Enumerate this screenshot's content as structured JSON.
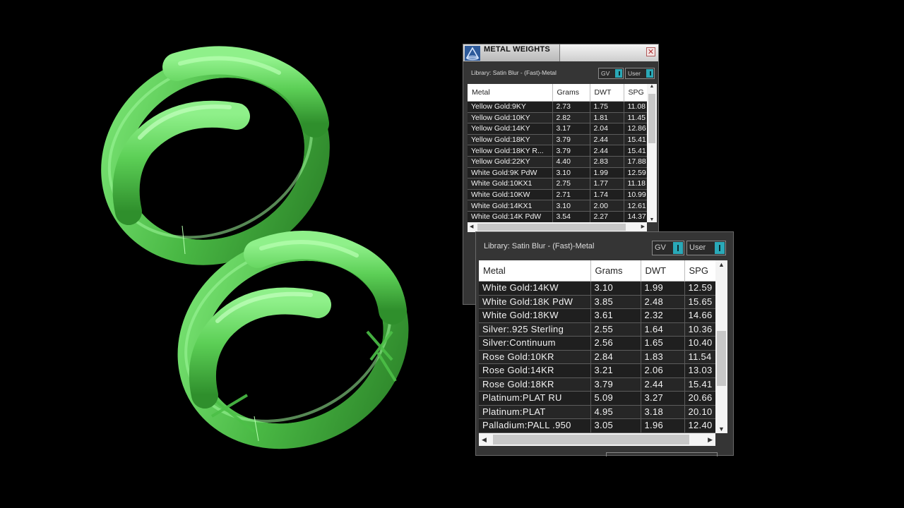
{
  "window1": {
    "title": "METAL WEIGHTS",
    "close_glyph": "✕",
    "library_label": "Library: Satin Blur - (Fast)-Metal",
    "toggle_gv": "GV",
    "toggle_user": "User",
    "columns": [
      "Metal",
      "Grams",
      "DWT",
      "SPG"
    ],
    "rows": [
      [
        "Yellow Gold:9KY",
        "2.73",
        "1.75",
        "11.08"
      ],
      [
        "Yellow Gold:10KY",
        "2.82",
        "1.81",
        "11.45"
      ],
      [
        "Yellow Gold:14KY",
        "3.17",
        "2.04",
        "12.86"
      ],
      [
        "Yellow Gold:18KY",
        "3.79",
        "2.44",
        "15.41"
      ],
      [
        "Yellow Gold:18KY R...",
        "3.79",
        "2.44",
        "15.41"
      ],
      [
        "Yellow Gold:22KY",
        "4.40",
        "2.83",
        "17.88"
      ],
      [
        "White Gold:9K PdW",
        "3.10",
        "1.99",
        "12.59"
      ],
      [
        "White Gold:10KX1",
        "2.75",
        "1.77",
        "11.18"
      ],
      [
        "White Gold:10KW",
        "2.71",
        "1.74",
        "10.99"
      ],
      [
        "White Gold:14KX1",
        "3.10",
        "2.00",
        "12.61"
      ],
      [
        "White Gold:14K PdW",
        "3.54",
        "2.27",
        "14.37"
      ]
    ],
    "scroll_up": "▲",
    "scroll_down": "▼",
    "scroll_left": "◀",
    "scroll_right": "▶"
  },
  "window2": {
    "library_label": "Library: Satin Blur - (Fast)-Metal",
    "toggle_gv": "GV",
    "toggle_user": "User",
    "columns": [
      "Metal",
      "Grams",
      "DWT",
      "SPG"
    ],
    "rows": [
      [
        "White Gold:14KW",
        "3.10",
        "1.99",
        "12.59"
      ],
      [
        "White Gold:18K PdW",
        "3.85",
        "2.48",
        "15.65"
      ],
      [
        "White Gold:18KW",
        "3.61",
        "2.32",
        "14.66"
      ],
      [
        "Silver:.925 Sterling",
        "2.55",
        "1.64",
        "10.36"
      ],
      [
        "Silver:Continuum",
        "2.56",
        "1.65",
        "10.40"
      ],
      [
        "Rose Gold:10KR",
        "2.84",
        "1.83",
        "11.54"
      ],
      [
        "Rose Gold:14KR",
        "3.21",
        "2.06",
        "13.03"
      ],
      [
        "Rose Gold:18KR",
        "3.79",
        "2.44",
        "15.41"
      ],
      [
        "Platinum:PLAT RU",
        "5.09",
        "3.27",
        "20.66"
      ],
      [
        "Platinum:PLAT",
        "4.95",
        "3.18",
        "20.10"
      ],
      [
        "Palladium:PALL .950",
        "3.05",
        "1.96",
        "12.40"
      ]
    ],
    "scroll_up": "▲",
    "scroll_down": "▼",
    "scroll_left": "◀",
    "scroll_right": "▶"
  },
  "colors": {
    "ring_green": "#5fd65a",
    "toggle_accent": "#2aa9b8",
    "viewport_bg": "#000000"
  },
  "icons": [
    "app-logo-icon",
    "close-icon",
    "scroll-up-icon",
    "scroll-down-icon",
    "scroll-left-icon",
    "scroll-right-icon"
  ]
}
